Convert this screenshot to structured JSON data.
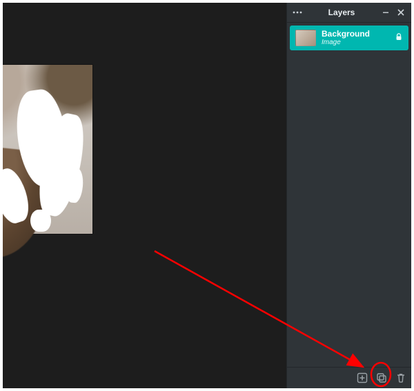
{
  "panel": {
    "title": "Layers"
  },
  "layer": {
    "name": "Background",
    "type": "Image"
  }
}
